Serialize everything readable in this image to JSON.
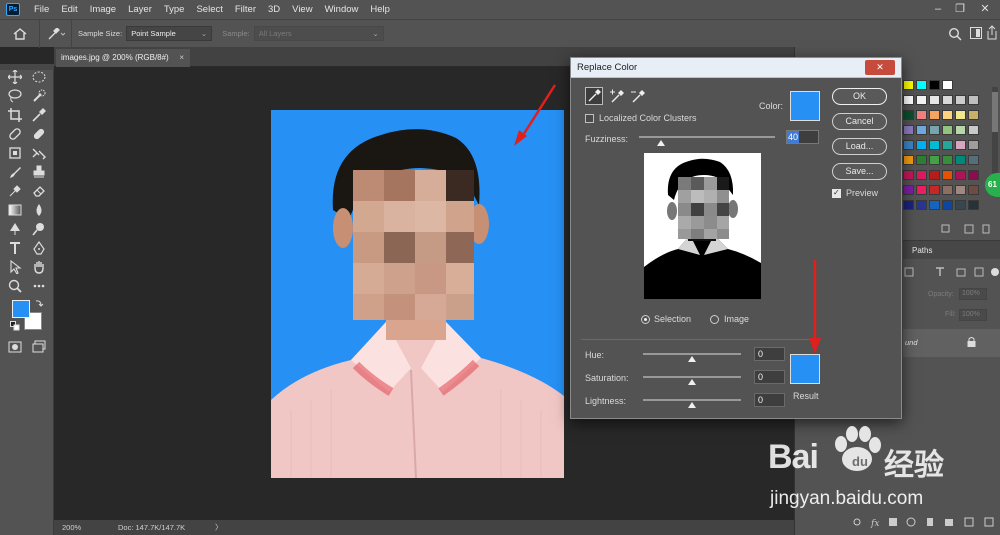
{
  "app": {
    "logo": "Ps"
  },
  "menu": [
    "File",
    "Edit",
    "Image",
    "Layer",
    "Type",
    "Select",
    "Filter",
    "3D",
    "View",
    "Window",
    "Help"
  ],
  "window_controls": {
    "minimize": "–",
    "restore": "❐",
    "close": "✕"
  },
  "options_bar": {
    "sample_size_label": "Sample Size:",
    "sample_size_value": "Point Sample",
    "sample_label": "Sample:",
    "sample_value": "All Layers"
  },
  "document": {
    "tab_title": "images.jpg @ 200% (RGB/8#)",
    "tab_close": "×"
  },
  "status_bar": {
    "zoom": "200%",
    "doc_info": "Doc: 147.7K/147.7K",
    "arrow": "〉"
  },
  "colors": {
    "foreground": "#2690f5",
    "background": "#ffffff",
    "arrow": "#e0201c",
    "photo_bg": "#2690f5"
  },
  "dialog": {
    "title": "Replace Color",
    "close_label": "✕",
    "localized_label": "Localized Color Clusters",
    "localized_checked": false,
    "color_label": "Color:",
    "fuzziness_label": "Fuzziness:",
    "fuzziness_value": "40",
    "fuzziness_level": 0.16,
    "selection_label": "Selection",
    "image_label": "Image",
    "preview_mode": "Selection",
    "buttons": {
      "ok": "OK",
      "cancel": "Cancel",
      "load": "Load...",
      "save": "Save..."
    },
    "preview_label": "Preview",
    "preview_checked": true,
    "hue_label": "Hue:",
    "hue_value": "0",
    "saturation_label": "Saturation:",
    "saturation_value": "0",
    "lightness_label": "Lightness:",
    "lightness_value": "0",
    "result_label": "Result",
    "picked_color": "#2690f5",
    "result_color": "#2690f5"
  },
  "panels": {
    "paths_tab": "Paths",
    "opacity_label": "Opacity:",
    "opacity_value": "100%",
    "fill_label": "Fill:",
    "fill_value": "100%",
    "layer_name": "und",
    "badge": "61",
    "swatches": [
      [
        "#ffff00",
        "#00ffff",
        "#000000",
        "#ffffff"
      ],
      [
        "#ffffff",
        "#f2f2f2",
        "#e6e6e6",
        "#d9d9d9",
        "#cccccc",
        "#bfbfbf"
      ],
      [
        "#0b4f2e",
        "#f08080",
        "#f4a460",
        "#ffd27f",
        "#f0e68c",
        "#c8b068"
      ],
      [
        "#8e7cc3",
        "#6fa8dc",
        "#76a5af",
        "#93c47d",
        "#b6d7a8",
        "#c9c9c9"
      ],
      [
        "#3d85c6",
        "#00b0f0",
        "#00bcd4",
        "#26a69a",
        "#d5a6bd",
        "#9e9e9e"
      ],
      [
        "#f39c12",
        "#2e7d32",
        "#43a047",
        "#388e3c",
        "#00897b",
        "#546e7a"
      ],
      [
        "#c2185b",
        "#d81b60",
        "#b71c1c",
        "#e65100",
        "#ad1457",
        "#880e4f"
      ],
      [
        "#7b1fa2",
        "#e91e63",
        "#c62828",
        "#8d6e63",
        "#a1887f",
        "#6d4c41"
      ],
      [
        "#1a237e",
        "#283593",
        "#1565c0",
        "#0d47a1",
        "#37474f",
        "#263238"
      ]
    ]
  },
  "watermark": {
    "brand_left": "Bai",
    "brand_right": "经验",
    "url": "jingyan.baidu.com"
  }
}
